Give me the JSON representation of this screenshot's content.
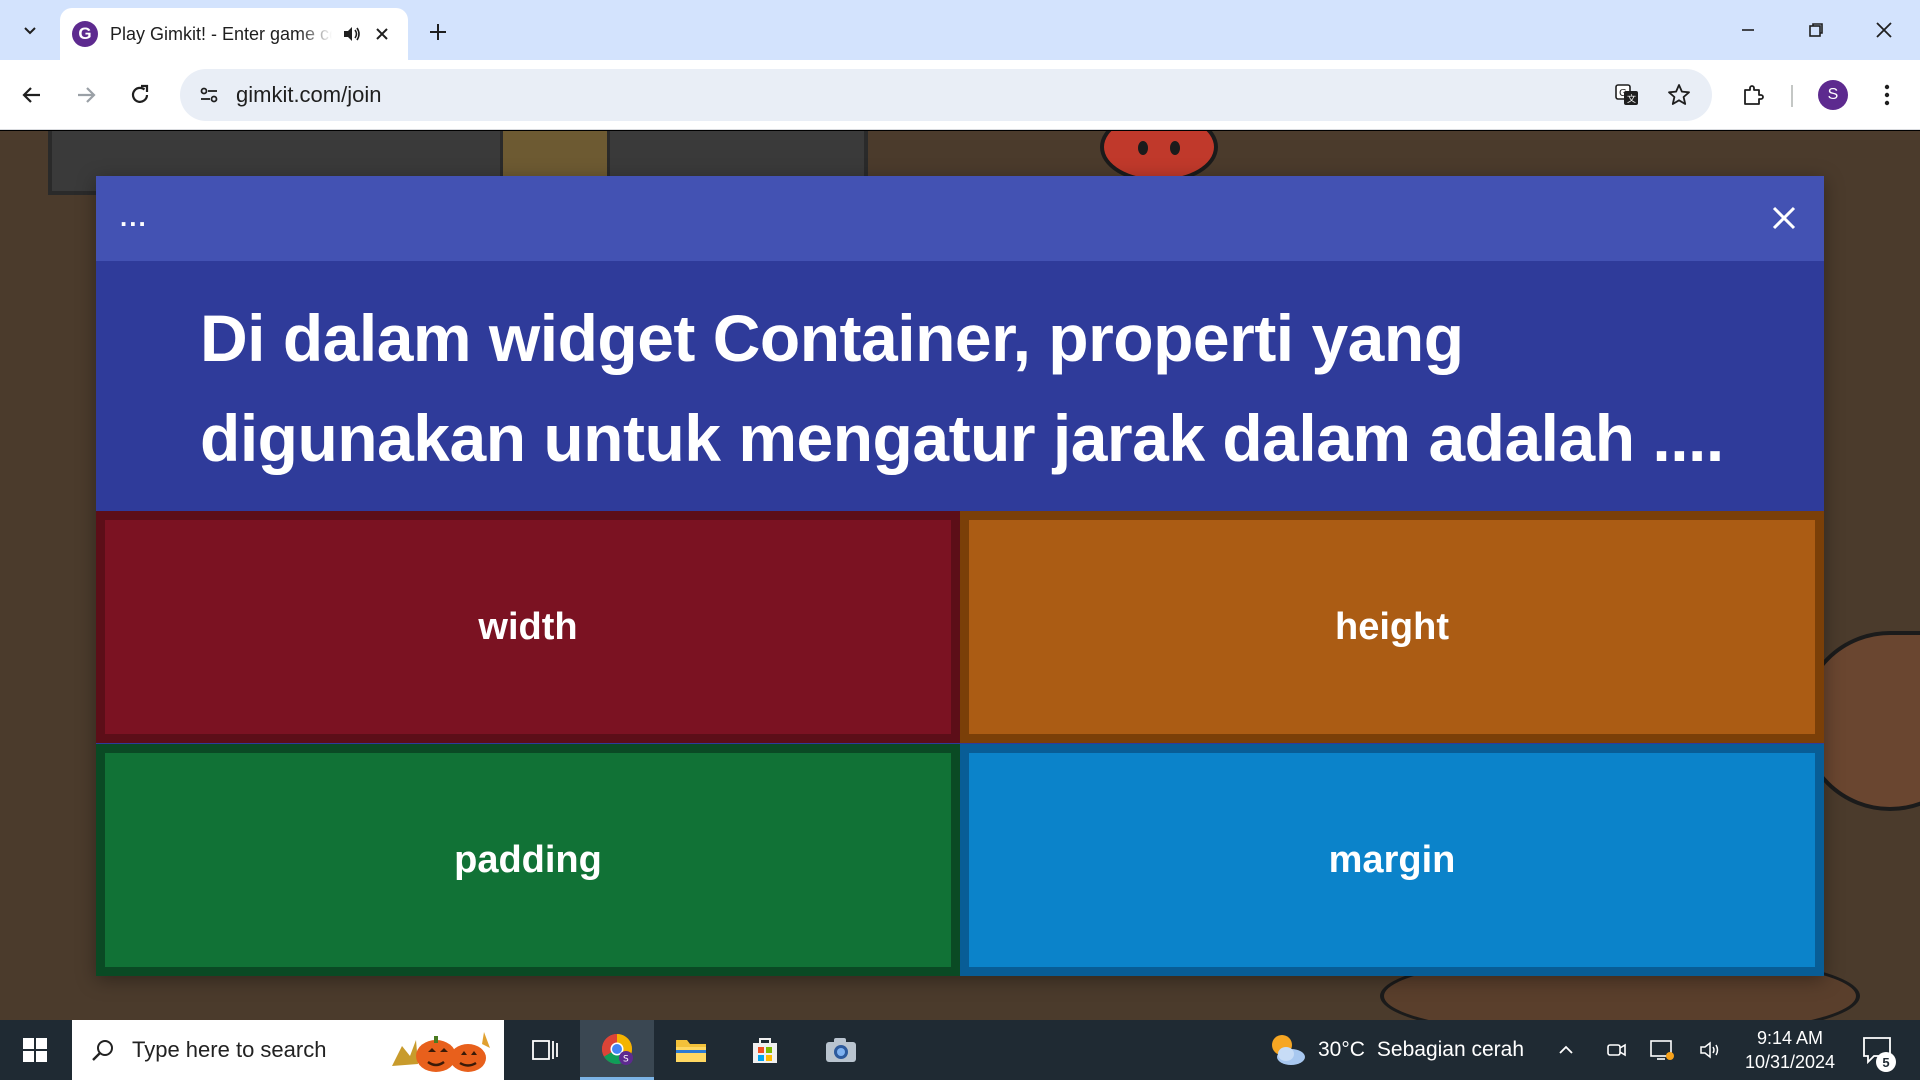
{
  "browser": {
    "tab": {
      "title": "Play Gimkit! - Enter game code",
      "favicon_letter": "G",
      "favicon_color": "#5d2a8f"
    },
    "address_bar": {
      "url": "gimkit.com/join"
    },
    "profile_initial": "S",
    "icons": [
      "tab-search-icon",
      "speaker-icon",
      "close-icon",
      "plus-icon",
      "back-icon",
      "forward-icon",
      "reload-icon",
      "site-info-icon",
      "translate-icon",
      "star-icon",
      "extensions-icon",
      "kebab-menu-icon",
      "minimize-icon",
      "restore-icon"
    ]
  },
  "question_modal": {
    "menu_label": "...",
    "question": "Di dalam widget Container, properti yang digunakan untuk mengatur jarak dalam adalah ....",
    "answers": [
      {
        "label": "width",
        "color": "#7b1222"
      },
      {
        "label": "height",
        "color": "#ab5c14"
      },
      {
        "label": "padding",
        "color": "#117236"
      },
      {
        "label": "margin",
        "color": "#0b83ca"
      }
    ],
    "header_color": "#4352b3",
    "body_color": "#2f3b9a"
  },
  "taskbar": {
    "search_placeholder": "Type here to search",
    "weather": {
      "temperature": "30°C",
      "condition": "Sebagian cerah"
    },
    "clock": {
      "time": "9:14 AM",
      "date": "10/31/2024"
    },
    "notification_count": "5"
  }
}
